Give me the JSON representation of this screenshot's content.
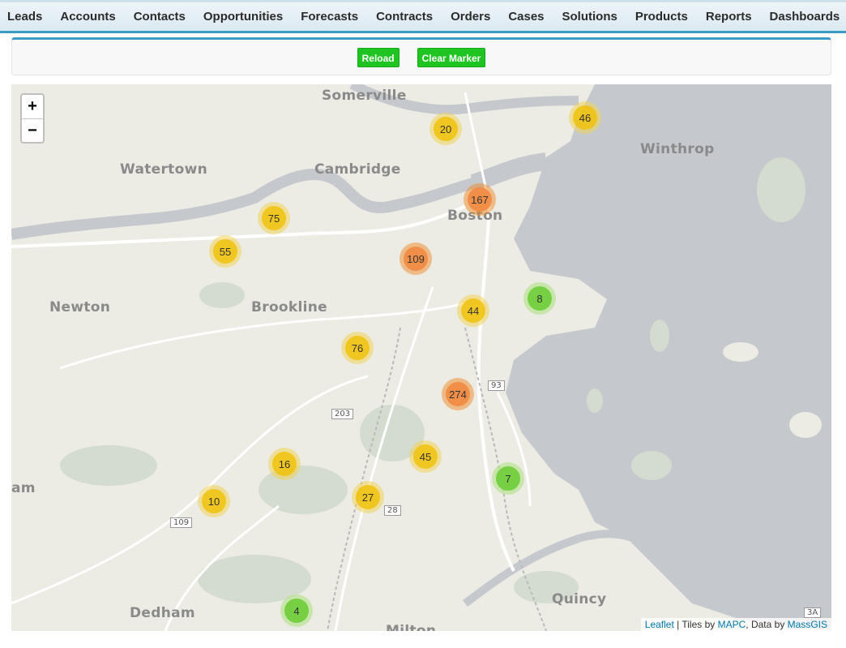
{
  "nav": {
    "items": [
      "Leads",
      "Accounts",
      "Contacts",
      "Opportunities",
      "Forecasts",
      "Contracts",
      "Orders",
      "Cases",
      "Solutions",
      "Products",
      "Reports",
      "Dashboards"
    ]
  },
  "toolbar": {
    "reload_label": "Reload",
    "clear_marker_label": "Clear Marker"
  },
  "map": {
    "zoom_in": "+",
    "zoom_out": "−",
    "places": {
      "somerville": "Somerville",
      "watertown": "Watertown",
      "cambridge": "Cambridge",
      "winthrop": "Winthrop",
      "boston": "Boston",
      "newton": "Newton",
      "brookline": "Brookline",
      "newton_edge": "am",
      "dedham": "Dedham",
      "quincy": "Quincy",
      "milton": "Milton"
    },
    "shields": {
      "r93": "93",
      "r203": "203",
      "r28": "28",
      "r109": "109",
      "r3a": "3A"
    },
    "clusters": {
      "c20": "20",
      "c46": "46",
      "c167": "167",
      "c75": "75",
      "c55": "55",
      "c109": "109",
      "c8": "8",
      "c44": "44",
      "c76": "76",
      "c274": "274",
      "c45": "45",
      "c16": "16",
      "c7": "7",
      "c10": "10",
      "c27": "27",
      "c4": "4"
    },
    "attribution": {
      "leaflet": "Leaflet",
      "sep1": " | Tiles by ",
      "mapc": "MAPC",
      "sep2": ", Data by ",
      "massgis": "MassGIS"
    }
  }
}
